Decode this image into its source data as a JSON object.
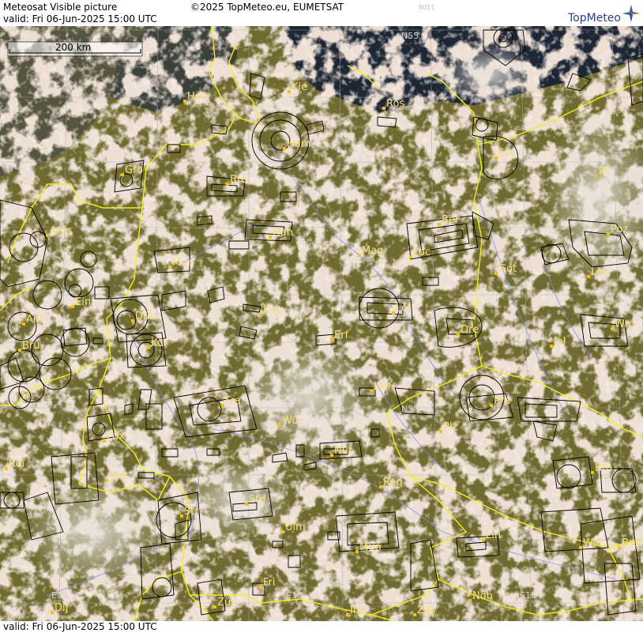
{
  "header": {
    "title": "Meteosat Visible picture",
    "valid": "valid:  Fri  06-Jun-2025  15:00 UTC",
    "copyright": "©2025 TopMeteo.eu, EUMETSAT",
    "code": "8011",
    "logo": "TopMeteo"
  },
  "scale": {
    "label": "200 km"
  },
  "footer": {
    "valid": "valid:  Fri  06-Jun-2025  15:00 UTC"
  },
  "grid_labels": {
    "n55": "N55",
    "n50": "N50",
    "e05": "E05",
    "e10": "E10",
    "e15": "E15"
  },
  "cities": [
    {
      "key": "hel",
      "label": "Hel"
    },
    {
      "key": "kie",
      "label": "Kie"
    },
    {
      "key": "ros",
      "label": "Ros"
    },
    {
      "key": "ham",
      "label": "Ham"
    },
    {
      "key": "szc",
      "label": "Szc"
    },
    {
      "key": "gro",
      "label": "Gro"
    },
    {
      "key": "bre",
      "label": "Bre"
    },
    {
      "key": "pil",
      "label": "Pil"
    },
    {
      "key": "ams",
      "label": "Ams"
    },
    {
      "key": "han",
      "label": "Han"
    },
    {
      "key": "ber",
      "label": "Ber"
    },
    {
      "key": "poz",
      "label": "Poz"
    },
    {
      "key": "mun",
      "label": "Mün"
    },
    {
      "key": "mag",
      "label": "Mag"
    },
    {
      "key": "loc",
      "label": "Loc"
    },
    {
      "key": "got",
      "label": "Got"
    },
    {
      "key": "les",
      "label": "Les"
    },
    {
      "key": "ein",
      "label": "Ein"
    },
    {
      "key": "kas",
      "label": "Kas"
    },
    {
      "key": "lei",
      "label": "Lei"
    },
    {
      "key": "ant",
      "label": "Ant"
    },
    {
      "key": "dus",
      "label": "Düs"
    },
    {
      "key": "dre",
      "label": "Dre"
    },
    {
      "key": "wro",
      "label": "Wro"
    },
    {
      "key": "bru",
      "label": "Bru"
    },
    {
      "key": "kol",
      "label": "Köl"
    },
    {
      "key": "erf",
      "label": "Erf"
    },
    {
      "key": "jel",
      "label": "Jel"
    },
    {
      "key": "hof",
      "label": "Hof"
    },
    {
      "key": "fra",
      "label": "Fra"
    },
    {
      "key": "pra",
      "label": "Pra"
    },
    {
      "key": "wur",
      "label": "Wür"
    },
    {
      "key": "plz",
      "label": "Plz"
    },
    {
      "key": "lux",
      "label": "Lux"
    },
    {
      "key": "nur",
      "label": "Nür"
    },
    {
      "key": "rei",
      "label": "Rei"
    },
    {
      "key": "met",
      "label": "Met"
    },
    {
      "key": "brn",
      "label": "Brn"
    },
    {
      "key": "reg",
      "label": "Reg"
    },
    {
      "key": "stu",
      "label": "Stu"
    },
    {
      "key": "str",
      "label": "Str"
    },
    {
      "key": "ulm",
      "label": "Ulm"
    },
    {
      "key": "lin",
      "label": "Lin"
    },
    {
      "key": "mun2",
      "label": "Mün"
    },
    {
      "key": "wie",
      "label": "Wie"
    },
    {
      "key": "bra",
      "label": "Bra"
    },
    {
      "key": "fri",
      "label": "Fri"
    },
    {
      "key": "zur",
      "label": "Zür"
    },
    {
      "key": "dij",
      "label": "Dij"
    },
    {
      "key": "inn",
      "label": "Inn"
    },
    {
      "key": "zas",
      "label": "Zas"
    },
    {
      "key": "nob",
      "label": "Nöb"
    }
  ],
  "colors": {
    "land": "#6f6a2f",
    "sea": "#1d2634",
    "cloud": "#d9b9a2",
    "cloud_bright": "#eadfd6",
    "border": "#f2ef1e",
    "river": "#7f8ef0",
    "city_label": "#f5e07a",
    "city_dot": "#f2c400",
    "grid": "#a8a8a8",
    "airspace": "#000000"
  }
}
